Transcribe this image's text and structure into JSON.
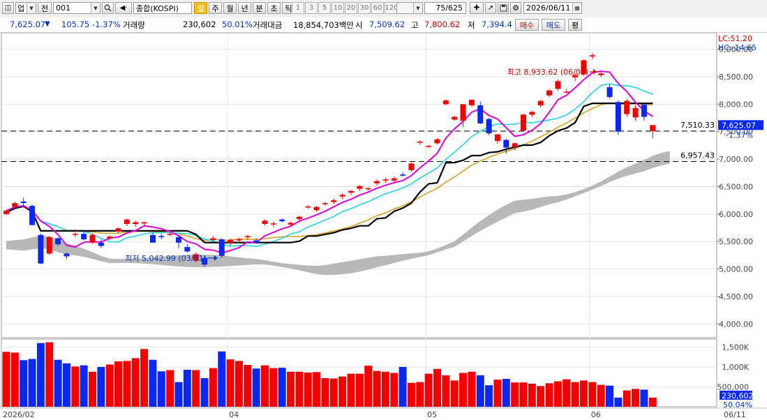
{
  "toolbar": {
    "market_code": "업",
    "prev_label": "전",
    "code_value": "001",
    "index_name": "종합(KOSPI)",
    "periods": [
      "일",
      "주",
      "월",
      "년",
      "분",
      "초",
      "틱"
    ],
    "intervals": [
      "1",
      "3",
      "5",
      "10",
      "20",
      "30",
      "60",
      "120"
    ],
    "count": "75/625",
    "date": "2026/06/11"
  },
  "info": {
    "price": "7,625.07",
    "arrow": "▼",
    "change": "105.75",
    "change_pct": "-1.37%",
    "volume_label": "거래량",
    "volume": "230,602",
    "volume_pct": "50.01%",
    "amount_label": "거래대금",
    "amount": "18,854,703백만",
    "open_label": "시",
    "open": "7,509.62",
    "high_label": "고",
    "high": "7,800.62",
    "low_label": "저",
    "low": "7,394.4",
    "buy_label": "매수",
    "sell_label": "매도",
    "avg_label": "평"
  },
  "chart_data": {
    "type": "candlestick",
    "y_ticks": [
      "9,000.00",
      "8,500.00",
      "8,000.00",
      "7,500.00",
      "7,000.00",
      "6,500.00",
      "6,000.00",
      "5,500.00",
      "5,000.00",
      "4,500.00",
      "4,000.00"
    ],
    "ylim": [
      3750,
      9300
    ],
    "x_ticks": [
      {
        "i": 0,
        "label": "2026/02"
      },
      {
        "i": 26,
        "label": "04"
      },
      {
        "i": 49,
        "label": "05"
      },
      {
        "i": 68,
        "label": "06"
      },
      {
        "i": 87,
        "label": "06/11"
      }
    ],
    "lc_label": "LC:51.20",
    "hc_label": "HC:-14.65",
    "max_label": "최고 8,933.62 (06/02)",
    "max_index": 69,
    "min_label": "최저 5,042.99 (03/31)",
    "min_index": 25,
    "ref_lines": [
      {
        "value": 7510.33,
        "label": "7,510.33"
      },
      {
        "value": 6957.43,
        "label": "6,957.43"
      }
    ],
    "last_price_label": "7,625.07",
    "last_pct_label": "-1.37%",
    "volume_ticks": [
      "1,500K",
      "1,000K",
      "500,000"
    ],
    "volume_max": 1700,
    "last_volume_label": "230,602",
    "last_volume_pct": "50.04%",
    "colors": {
      "up": "#f40000",
      "down": "#0a28f0",
      "ma5": "#e000e0",
      "ma10": "#22d4e8",
      "ma20": "#d8a020",
      "line": "#000000",
      "cloud": "#b4b4b4"
    },
    "candles": [
      [
        6000,
        6080,
        5980,
        6060
      ],
      [
        6130,
        6230,
        6100,
        6200
      ],
      [
        6230,
        6300,
        6150,
        6200
      ],
      [
        6150,
        6170,
        5790,
        5800
      ],
      [
        5620,
        5640,
        5090,
        5100
      ],
      [
        5280,
        5600,
        5260,
        5580
      ],
      [
        5560,
        5580,
        5420,
        5450
      ],
      [
        5280,
        5300,
        5180,
        5230
      ],
      [
        5630,
        5720,
        5580,
        5640
      ],
      [
        5640,
        5700,
        5520,
        5540
      ],
      [
        5480,
        5640,
        5460,
        5620
      ],
      [
        5480,
        5540,
        5380,
        5420
      ],
      [
        5560,
        5610,
        5520,
        5590
      ],
      [
        5680,
        5760,
        5640,
        5740
      ],
      [
        5820,
        5920,
        5780,
        5900
      ],
      [
        5820,
        5880,
        5770,
        5850
      ],
      [
        5830,
        5860,
        5790,
        5850
      ],
      [
        5620,
        5660,
        5480,
        5480
      ],
      [
        5600,
        5640,
        5540,
        5580
      ],
      [
        5640,
        5670,
        5600,
        5640
      ],
      [
        5580,
        5620,
        5380,
        5480
      ],
      [
        5400,
        5450,
        5300,
        5320
      ],
      [
        5150,
        5300,
        5120,
        5270
      ],
      [
        5200,
        5240,
        5042,
        5080
      ],
      [
        5530,
        5600,
        5480,
        5560
      ],
      [
        5540,
        5560,
        5200,
        5240
      ],
      [
        5480,
        5560,
        5420,
        5530
      ],
      [
        5520,
        5570,
        5480,
        5540
      ],
      [
        5580,
        5620,
        5540,
        5600
      ],
      [
        5520,
        5560,
        5460,
        5480
      ],
      [
        5820,
        5900,
        5790,
        5880
      ],
      [
        5810,
        5870,
        5760,
        5830
      ],
      [
        5900,
        5920,
        5850,
        5870
      ],
      [
        5810,
        5860,
        5780,
        5840
      ],
      [
        5910,
        5970,
        5870,
        5950
      ],
      [
        6120,
        6160,
        6100,
        6140
      ],
      [
        6070,
        6150,
        6040,
        6130
      ],
      [
        6180,
        6220,
        6150,
        6200
      ],
      [
        6220,
        6280,
        6180,
        6250
      ],
      [
        6320,
        6380,
        6270,
        6350
      ],
      [
        6390,
        6440,
        6350,
        6420
      ],
      [
        6460,
        6530,
        6420,
        6510
      ],
      [
        6460,
        6490,
        6420,
        6470
      ],
      [
        6560,
        6630,
        6520,
        6600
      ],
      [
        6610,
        6660,
        6570,
        6630
      ],
      [
        6610,
        6680,
        6580,
        6650
      ],
      [
        6720,
        6760,
        6680,
        6700
      ],
      [
        6800,
        6940,
        6770,
        6920
      ],
      [
        7300,
        7340,
        7260,
        7320
      ],
      [
        7240,
        7260,
        7210,
        7240
      ],
      [
        7290,
        7380,
        7270,
        7360
      ],
      [
        8000,
        8090,
        7980,
        8070
      ],
      [
        7720,
        7790,
        7700,
        7770
      ],
      [
        7700,
        8000,
        7580,
        8000
      ],
      [
        7980,
        8090,
        7950,
        8080
      ],
      [
        7980,
        8050,
        7640,
        7650
      ],
      [
        7730,
        7750,
        7440,
        7470
      ],
      [
        7330,
        7460,
        7280,
        7450
      ],
      [
        7350,
        7370,
        7100,
        7210
      ],
      [
        7220,
        7300,
        7160,
        7290
      ],
      [
        7520,
        7830,
        7500,
        7810
      ],
      [
        7810,
        7880,
        7770,
        7860
      ],
      [
        7980,
        8080,
        7940,
        8060
      ],
      [
        8160,
        8280,
        8130,
        8250
      ],
      [
        8280,
        8450,
        8240,
        8420
      ],
      [
        8220,
        8280,
        8200,
        8230
      ],
      [
        8490,
        8560,
        8420,
        8530
      ],
      [
        8550,
        8820,
        8520,
        8800
      ],
      [
        8870,
        8933,
        8820,
        8890
      ],
      [
        8530,
        8590,
        8490,
        8560
      ],
      [
        8310,
        8360,
        8100,
        8130
      ],
      [
        8040,
        8070,
        7440,
        7500
      ],
      [
        7820,
        8100,
        7770,
        8060
      ],
      [
        7760,
        7980,
        7700,
        7930
      ],
      [
        7990,
        8010,
        7700,
        7770
      ],
      [
        7510,
        7620,
        7380,
        7620
      ]
    ],
    "volumes": [
      1380,
      1360,
      1170,
      1200,
      1600,
      1620,
      1180,
      1090,
      1010,
      1040,
      880,
      1000,
      1060,
      1140,
      1150,
      1220,
      1450,
      1180,
      890,
      920,
      620,
      930,
      920,
      720,
      970,
      1390,
      1190,
      1150,
      1050,
      960,
      1040,
      970,
      980,
      880,
      880,
      860,
      870,
      720,
      710,
      760,
      830,
      830,
      1030,
      900,
      880,
      850,
      1000,
      600,
      620,
      830,
      950,
      790,
      660,
      850,
      880,
      790,
      540,
      680,
      700,
      610,
      610,
      580,
      520,
      590,
      640,
      690,
      620,
      660,
      620,
      550,
      530,
      230,
      410,
      450,
      430,
      230
    ]
  }
}
